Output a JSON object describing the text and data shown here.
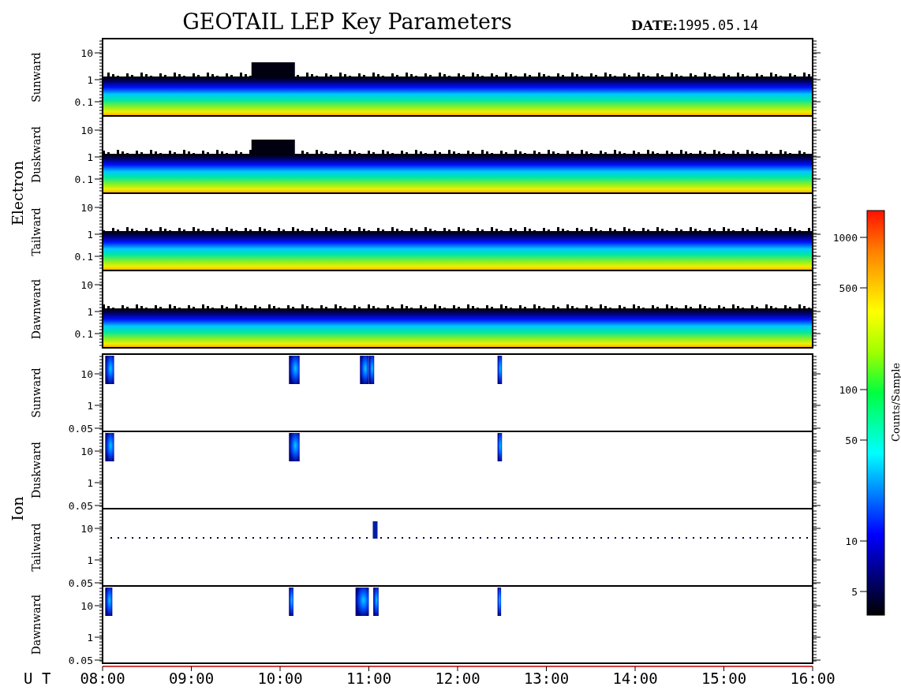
{
  "title": "GEOTAIL LEP Key Parameters",
  "date_label": "DATE:",
  "date": "1995.05.14",
  "groups": [
    {
      "label": "Electron",
      "kind": "electron",
      "panels": [
        {
          "label": "Sunward",
          "y_ticks": [
            "10",
            "1",
            "0.1"
          ]
        },
        {
          "label": "Duskward",
          "y_ticks": [
            "10",
            "1",
            "0.1"
          ]
        },
        {
          "label": "Tailward",
          "y_ticks": [
            "10",
            "1",
            "0.1"
          ]
        },
        {
          "label": "Dawnward",
          "y_ticks": [
            "10",
            "1",
            "0.1"
          ]
        }
      ]
    },
    {
      "label": "Ion",
      "kind": "ion",
      "panels": [
        {
          "label": "Sunward",
          "y_ticks": [
            "10",
            "1",
            "0.05"
          ]
        },
        {
          "label": "Duskward",
          "y_ticks": [
            "10",
            "1",
            "0.05"
          ]
        },
        {
          "label": "Tailward",
          "y_ticks": [
            "10",
            "1",
            "0.05"
          ]
        },
        {
          "label": "Dawnward",
          "y_ticks": [
            "10",
            "1",
            "0.05"
          ]
        }
      ]
    }
  ],
  "x_axis": {
    "label": "U T",
    "ticks": [
      "08:00",
      "09:00",
      "10:00",
      "11:00",
      "12:00",
      "13:00",
      "14:00",
      "15:00",
      "16:00"
    ]
  },
  "colorbar": {
    "label": "Counts/Sample",
    "ticks": [
      "1000",
      "500",
      "100",
      "50",
      "10",
      "5"
    ]
  }
}
